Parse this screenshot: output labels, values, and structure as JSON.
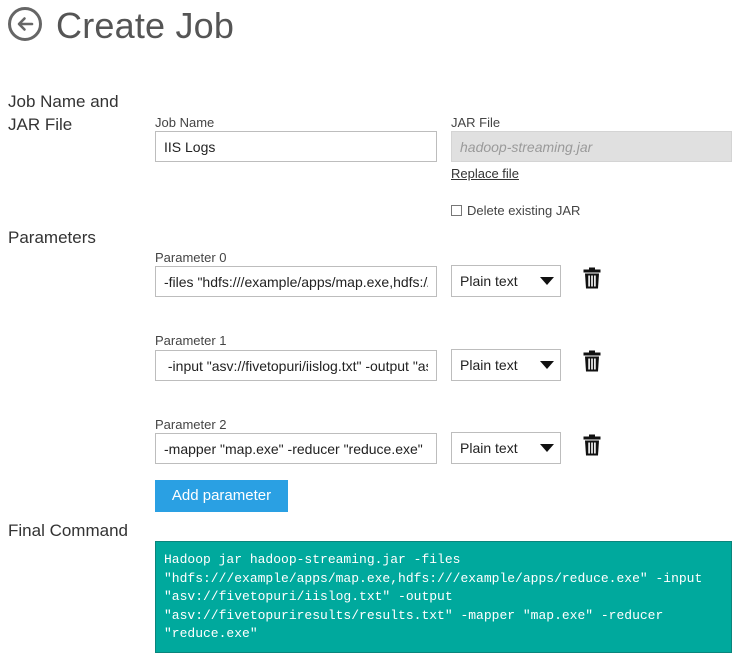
{
  "header": {
    "title": "Create Job",
    "back_icon": "back-arrow-icon"
  },
  "sections": {
    "job_name_jar": [
      "Job Name and",
      "JAR File"
    ],
    "parameters": "Parameters",
    "final_command": "Final Command"
  },
  "job": {
    "name_label": "Job Name",
    "name_value": "IIS Logs",
    "jar_label": "JAR File",
    "jar_value": "hadoop-streaming.jar",
    "replace_file_link": "Replace file",
    "delete_existing_label": "Delete existing JAR",
    "delete_existing_checked": false
  },
  "parameters": [
    {
      "label": "Parameter 0",
      "value": "-files \"hdfs:///example/apps/map.exe,hdfs:///example/apps/reduce.exe\"",
      "type": "Plain text"
    },
    {
      "label": "Parameter 1",
      "value": " -input \"asv://fivetopuri/iislog.txt\" -output \"asv://fivetopuriresults/results.txt\"",
      "type": "Plain text"
    },
    {
      "label": "Parameter 2",
      "value": "-mapper \"map.exe\" -reducer \"reduce.exe\"",
      "type": "Plain text"
    }
  ],
  "add_parameter_label": "Add parameter",
  "final_command_lines": [
    "Hadoop jar hadoop-streaming.jar -files",
    "\"hdfs:///example/apps/map.exe,hdfs:///example/apps/reduce.exe\" -input",
    "\"asv://fivetopuri/iislog.txt\" -output",
    "\"asv://fivetopuriresults/results.txt\" -mapper \"map.exe\" -reducer",
    "\"reduce.exe\""
  ],
  "colors": {
    "accent_button": "#2aa0e3",
    "command_background": "#00a99d"
  }
}
